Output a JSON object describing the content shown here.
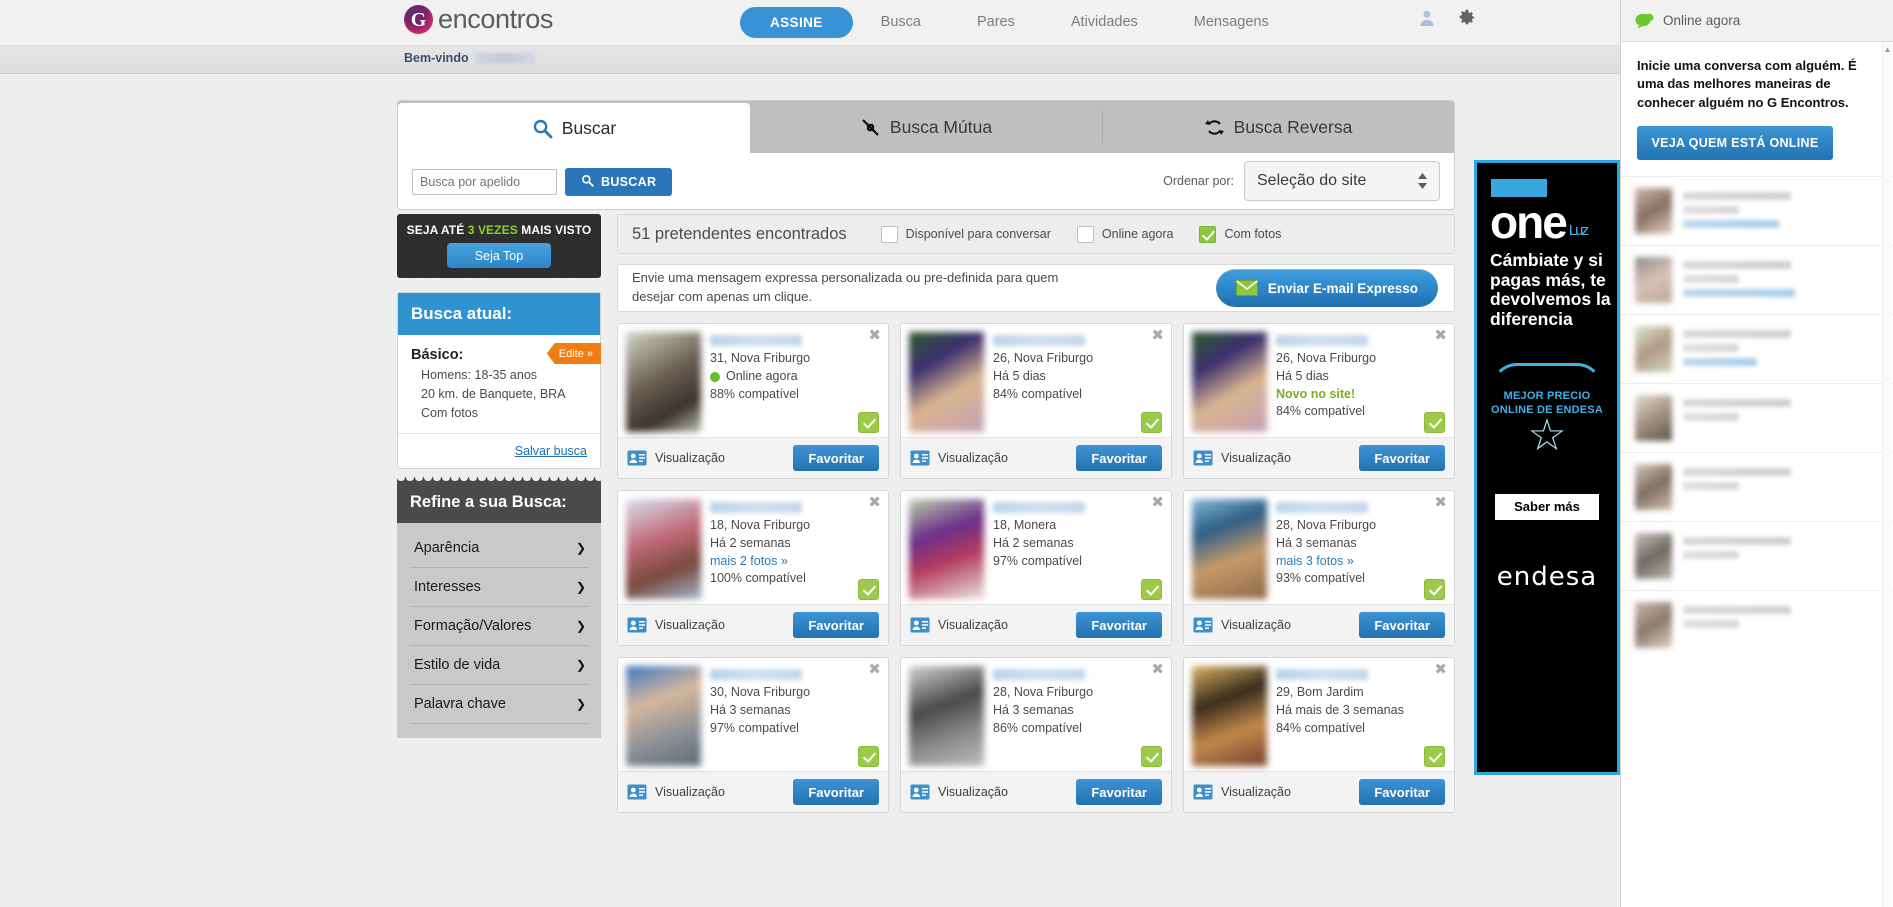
{
  "header": {
    "logo_text": "encontros",
    "logo_mark": "G",
    "nav": {
      "assine": "ASSINE",
      "links": [
        "Busca",
        "Pares",
        "Atividades",
        "Mensagens"
      ]
    },
    "icons": [
      "person-icon",
      "gear-icon"
    ]
  },
  "welcome": {
    "label": "Bem-vindo"
  },
  "search_panel": {
    "tabs": [
      {
        "label": "Buscar",
        "icon": "magnifier-icon",
        "active": true
      },
      {
        "label": "Busca Mútua",
        "icon": "mutual-arrows-icon",
        "active": false
      },
      {
        "label": "Busca Reversa",
        "icon": "recycle-arrows-icon",
        "active": false
      }
    ],
    "nick_placeholder": "Busca por apelido",
    "nick_value": "",
    "search_button": "BUSCAR",
    "order_label": "Ordenar por:",
    "order_value": "Seleção do site"
  },
  "promo": {
    "line_pre": "SEJA ATÉ ",
    "line_hi": "3 VEZES",
    "line_post": " MAIS VISTO",
    "button": "Seja Top"
  },
  "current_search": {
    "title": "Busca atual:",
    "subtitle": "Básico:",
    "edit_label": "Edite »",
    "criteria": [
      "Homens: 18-35 anos",
      "20 km. de Banquete, BRA",
      "Com fotos"
    ],
    "save_link": "Salvar busca"
  },
  "refine": {
    "title": "Refine a sua Busca:",
    "items": [
      "Aparência",
      "Interesses",
      "Formação/Valores",
      "Estilo de vida",
      "Palavra chave"
    ]
  },
  "results_bar": {
    "count_text": "51 pretendentes encontrados",
    "filters": [
      {
        "label": "Disponível para conversar",
        "checked": false
      },
      {
        "label": "Online agora",
        "checked": false
      },
      {
        "label": "Com fotos",
        "checked": true
      }
    ]
  },
  "express": {
    "text": "Envie uma mensagem expressa personalizada ou pre-definida para quem desejar com apenas um clique.",
    "button": "Enviar E-mail Expresso"
  },
  "cards_common": {
    "view_label": "Visualização",
    "favorite_label": "Favoritar",
    "close_icon": "✖"
  },
  "profiles": [
    {
      "age_city": "31, Nova Friburgo",
      "status": "Online agora",
      "status_type": "online",
      "extra": "",
      "compat": "88% compatível",
      "thumb": "#8d8a7e"
    },
    {
      "age_city": "26, Nova Friburgo",
      "status": "Há 5 dias",
      "status_type": "plain",
      "extra": "",
      "compat": "84% compatível",
      "thumb": "#7a6a84"
    },
    {
      "age_city": "26, Nova Friburgo",
      "status": "Há 5 dias",
      "status_type": "plain",
      "extra": "Novo no site!",
      "extra_type": "new",
      "compat": "84% compatível",
      "thumb": "#7a6a84"
    },
    {
      "age_city": "18, Nova Friburgo",
      "status": "Há 2 semanas",
      "status_type": "plain",
      "extra": "mais 2 fotos »",
      "extra_type": "link",
      "compat": "100% compatível",
      "thumb": "#a98392"
    },
    {
      "age_city": "18, Monera",
      "status": "Há 2 semanas",
      "status_type": "plain",
      "extra": "",
      "compat": "97% compatível",
      "thumb": "#9a7fa8"
    },
    {
      "age_city": "28, Nova Friburgo",
      "status": "Há 3 semanas",
      "status_type": "plain",
      "extra": "mais 3 fotos »",
      "extra_type": "link",
      "compat": "93% compatível",
      "thumb": "#7897b4"
    },
    {
      "age_city": "30, Nova Friburgo",
      "status": "Há 3 semanas",
      "status_type": "plain",
      "extra": "",
      "compat": "97% compatível",
      "thumb": "#8f9aa6"
    },
    {
      "age_city": "28, Nova Friburgo",
      "status": "Há 3 semanas",
      "status_type": "plain",
      "extra": "",
      "compat": "86% compatível",
      "thumb": "#9b9b9b"
    },
    {
      "age_city": "29, Bom Jardim",
      "status": "Há mais de 3 semanas",
      "status_type": "plain",
      "extra": "",
      "compat": "84% compatível",
      "thumb": "#b08d4a"
    }
  ],
  "ad": {
    "brand_one": "one",
    "brand_sub": "Luz",
    "claim": "Cámbiate y si pagas más, te devolvemos la diferencia",
    "badge_line1": "MEJOR PRECIO",
    "badge_line2": "ONLINE DE ENDESA",
    "button": "Saber más",
    "brand": "endesa",
    "accent_color": "#29a8e0"
  },
  "chat": {
    "header": "Online agora",
    "intro": "Inicie uma conversa com alguém. É uma das melhores maneiras de conhecer alguém no G Encontros.",
    "cta": "VEJA QUEM ESTÁ ONLINE",
    "items": [
      1,
      2,
      3,
      4,
      5,
      6,
      7
    ]
  },
  "colors": {
    "accent_blue": "#2a76b8",
    "nav_blue": "#3793d5",
    "green": "#8dc63f",
    "orange": "#f07c14"
  }
}
